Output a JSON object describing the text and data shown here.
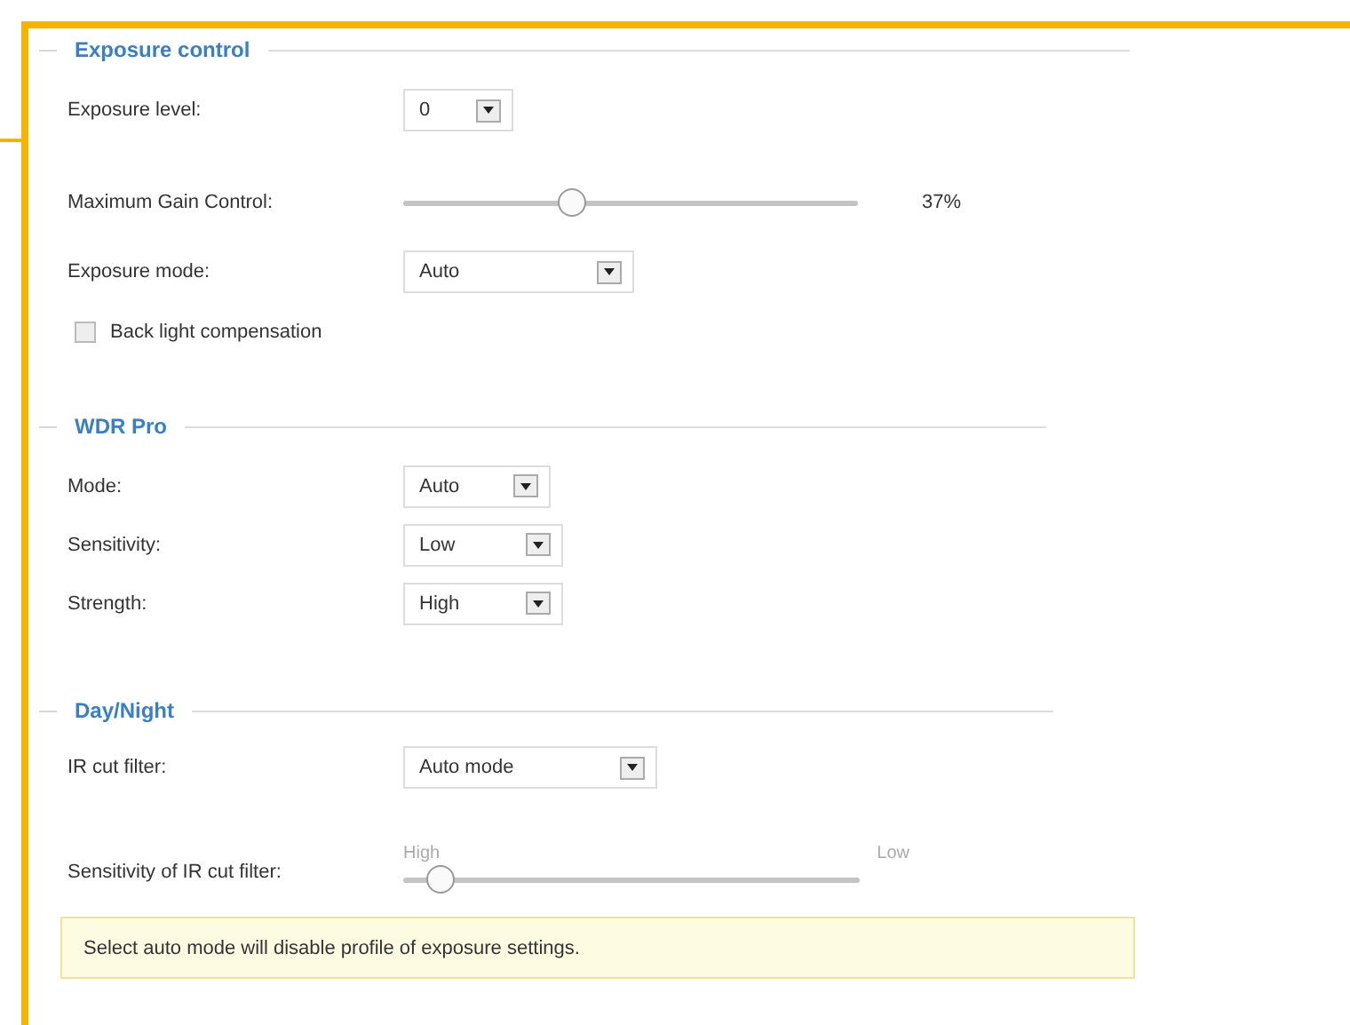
{
  "sections": [
    {
      "legend": "Exposure control",
      "rows": [
        {
          "kind": "select",
          "label": "Exposure level:",
          "value": "0"
        },
        {
          "kind": "slider",
          "label": "Maximum Gain Control:",
          "level": 0.37,
          "reading": "37%"
        },
        {
          "kind": "select",
          "label": "Exposure mode:",
          "value": "Auto"
        },
        {
          "kind": "checkbox",
          "label": "Back light compensation",
          "checked": false
        }
      ]
    },
    {
      "legend": "WDR Pro",
      "rows": [
        {
          "kind": "select",
          "label": "Mode:",
          "value": "Auto"
        },
        {
          "kind": "select",
          "label": "Sensitivity:",
          "value": "Low"
        },
        {
          "kind": "select",
          "label": "Strength:",
          "value": "High"
        }
      ]
    },
    {
      "legend": "Day/Night",
      "rows": [
        {
          "kind": "select",
          "label": "IR cut filter:",
          "value": "Auto mode"
        },
        {
          "kind": "slider",
          "label": "Sensitivity of IR cut filter:",
          "level": 0.08,
          "min_label": "High",
          "max_label": "Low"
        },
        {
          "kind": "note",
          "text": "Select auto mode will disable profile of exposure settings."
        }
      ]
    }
  ]
}
